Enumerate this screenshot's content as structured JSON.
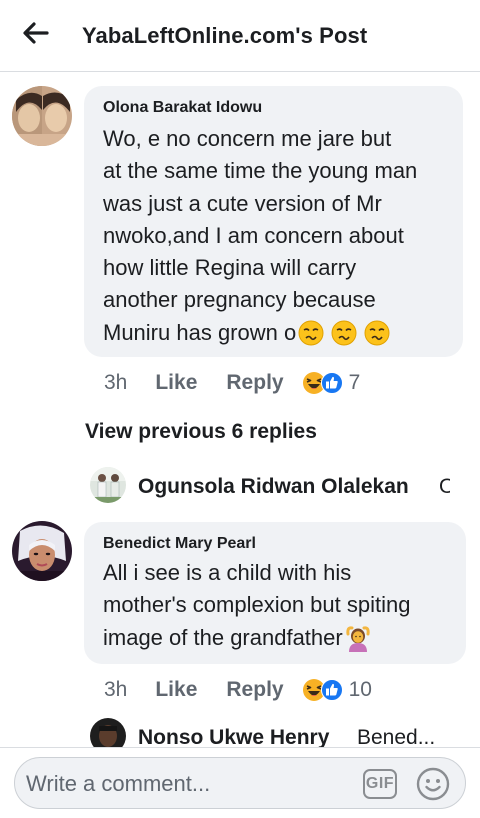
{
  "header": {
    "title": "YabaLeftOnline.com's Post",
    "back_icon": "arrow-left-icon"
  },
  "comments": [
    {
      "author": "Olona Barakat Idowu",
      "text": "Wo, e no concern me jare but at the same time the young man was just a cute version of Mr nwoko,and I am concern about how little Regina will carry another pregnancy because Muniru has grown o",
      "text_lines": [
        "Wo, e no concern me jare but",
        "at the same time the young man",
        "was just a cute version of Mr",
        "nwoko,and I am concern about",
        "how little Regina will carry",
        "another pregnancy because",
        "Muniru has grown o"
      ],
      "trailing_emoji": [
        "woozy-face-icon",
        "woozy-face-icon",
        "woozy-face-icon"
      ],
      "time": "3h",
      "like_label": "Like",
      "reply_label": "Reply",
      "reactions": [
        "haha-reaction-icon",
        "like-reaction-icon"
      ],
      "reaction_count": "7"
    },
    {
      "author": "Benedict Mary Pearl",
      "text": "All i see is a child with his mother's complexion but spiting image of the grandfather",
      "text_lines": [
        "All i see is a child with his",
        "mother's complexion but spiting",
        "image of the grandfather"
      ],
      "trailing_emoji": [
        "person-gesturing-ok-icon"
      ],
      "time": "3h",
      "like_label": "Like",
      "reply_label": "Reply",
      "reactions": [
        "haha-reaction-icon",
        "like-reaction-icon"
      ],
      "reaction_count": "10"
    }
  ],
  "view_previous": "View previous 6 replies",
  "replies": [
    {
      "author": "Ogunsola Ridwan Olalekan",
      "snippet": "O"
    },
    {
      "author": "Nonso Ukwe Henry",
      "snippet": "Bened..."
    }
  ],
  "composer": {
    "placeholder": "Write a comment...",
    "gif_label": "GIF",
    "emoji_icon": "smiley-icon"
  }
}
